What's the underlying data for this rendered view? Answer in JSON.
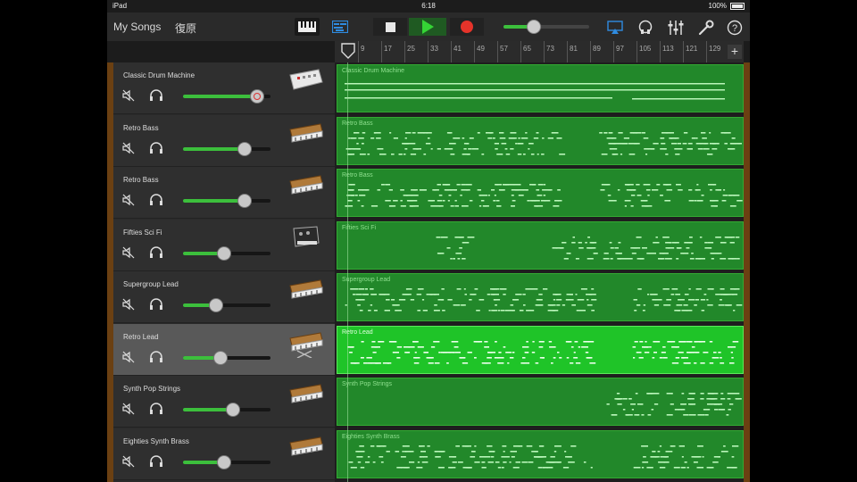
{
  "status_bar": {
    "device": "iPad",
    "time": "6:18",
    "battery": "100%"
  },
  "toolbar": {
    "my_songs_label": "My Songs",
    "undo_label": "復原",
    "view_keys_icon": "keyboard-icon",
    "view_tracks_icon": "tracks-view-icon",
    "stop_icon": "stop-icon",
    "play_icon": "play-icon",
    "record_icon": "record-icon",
    "master_volume": 0.35,
    "right_icons": [
      "airplay-icon",
      "headphones-loop-icon",
      "mixer-icon",
      "wrench-icon",
      "help-icon"
    ]
  },
  "ruler": {
    "bars": [
      "9",
      "17",
      "25",
      "33",
      "41",
      "49",
      "57",
      "65",
      "73",
      "81",
      "89",
      "97",
      "105",
      "113",
      "121",
      "129"
    ]
  },
  "colors": {
    "region": "#22882a",
    "region_selected": "#1fc428",
    "accent_green": "#3cbf3c",
    "record": "#e5332a",
    "wood": "#6b4012"
  },
  "tracks": [
    {
      "name": "Classic Drum Machine",
      "volume": 0.85,
      "icon": "drum-machine-icon",
      "selected": false,
      "region_label": "Classic Drum Machine"
    },
    {
      "name": "Retro Bass",
      "volume": 0.7,
      "icon": "synth-keyboard-icon",
      "selected": false,
      "region_label": "Retro Bass"
    },
    {
      "name": "Retro Bass",
      "volume": 0.7,
      "icon": "synth-keyboard-icon",
      "selected": false,
      "region_label": "Retro Bass"
    },
    {
      "name": "Fifties Sci Fi",
      "volume": 0.47,
      "icon": "scifi-synth-icon",
      "selected": false,
      "region_label": "Fifties Sci Fi"
    },
    {
      "name": "Supergroup Lead",
      "volume": 0.38,
      "icon": "synth-keyboard-icon",
      "selected": false,
      "region_label": "Supergroup Lead"
    },
    {
      "name": "Retro Lead",
      "volume": 0.43,
      "icon": "synth-keyboard-stand-icon",
      "selected": true,
      "region_label": "Retro Lead"
    },
    {
      "name": "Synth Pop Strings",
      "volume": 0.57,
      "icon": "synth-keyboard-icon",
      "selected": false,
      "region_label": "Synth Pop Strings"
    },
    {
      "name": "Eighties Synth Brass",
      "volume": 0.47,
      "icon": "synth-keyboard-icon",
      "selected": false,
      "region_label": "Eighties Synth Brass"
    }
  ]
}
